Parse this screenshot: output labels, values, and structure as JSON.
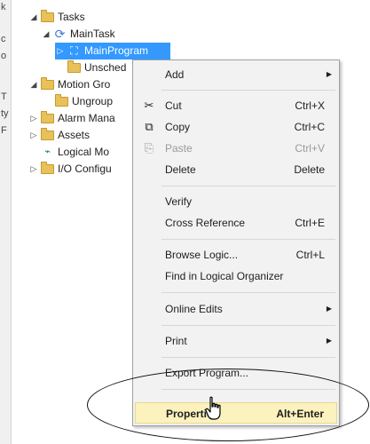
{
  "left_strip": [
    "k",
    "c",
    "o",
    "T",
    "ty",
    "F"
  ],
  "tree": {
    "tasks": "Tasks",
    "main_task": "MainTask",
    "main_program": "MainProgram",
    "unscheduled": "Unsched",
    "motion_groups": "Motion Gro",
    "ungrouped": "Ungroup",
    "alarm_manager": "Alarm Mana",
    "assets": "Assets",
    "logical_model": "Logical Mo",
    "io_configuration": "I/O Configu"
  },
  "context_menu": {
    "add": "Add",
    "cut": "Cut",
    "cut_shortcut": "Ctrl+X",
    "copy": "Copy",
    "copy_shortcut": "Ctrl+C",
    "paste": "Paste",
    "paste_shortcut": "Ctrl+V",
    "delete": "Delete",
    "delete_shortcut": "Delete",
    "verify": "Verify",
    "cross_reference": "Cross Reference",
    "cross_reference_shortcut": "Ctrl+E",
    "browse_logic": "Browse Logic...",
    "browse_logic_shortcut": "Ctrl+L",
    "find_in_logical_organizer": "Find in Logical Organizer",
    "online_edits": "Online Edits",
    "print": "Print",
    "export_program": "Export Program...",
    "properties": "Properties",
    "properties_shortcut": "Alt+Enter"
  },
  "colors": {
    "selection": "#3399ff",
    "menu_background": "#f2f2f2",
    "highlight": "#fbf2be",
    "folder": "#e8c15a"
  }
}
